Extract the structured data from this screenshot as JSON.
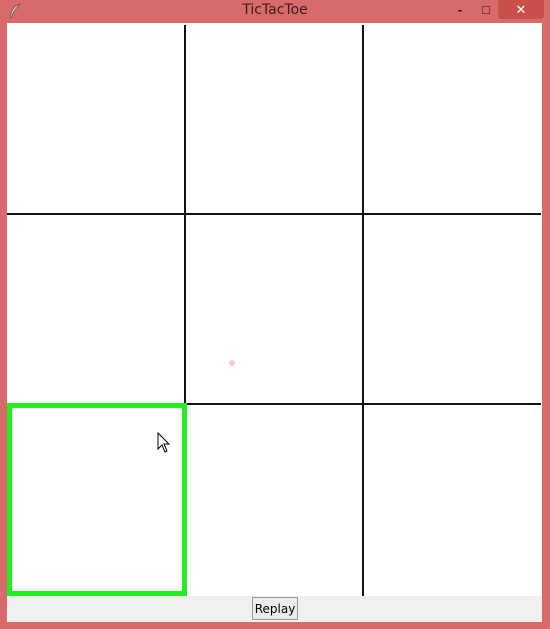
{
  "window": {
    "title": "TicTacToe",
    "minimize_label": "-",
    "maximize_label": "□",
    "close_label": "✕"
  },
  "board": {
    "rows": 3,
    "cols": 3,
    "cells": [
      "",
      "",
      "",
      "",
      "",
      "",
      "",
      "",
      ""
    ],
    "highlighted_cell": {
      "row": 2,
      "col": 0
    },
    "highlight_color": "#22ee22"
  },
  "replay_button": {
    "label": "Replay"
  },
  "colors": {
    "frame": "#d96a6a",
    "close_button": "#c9504a",
    "grid_line": "#111111",
    "board_bg": "#ffffff"
  }
}
